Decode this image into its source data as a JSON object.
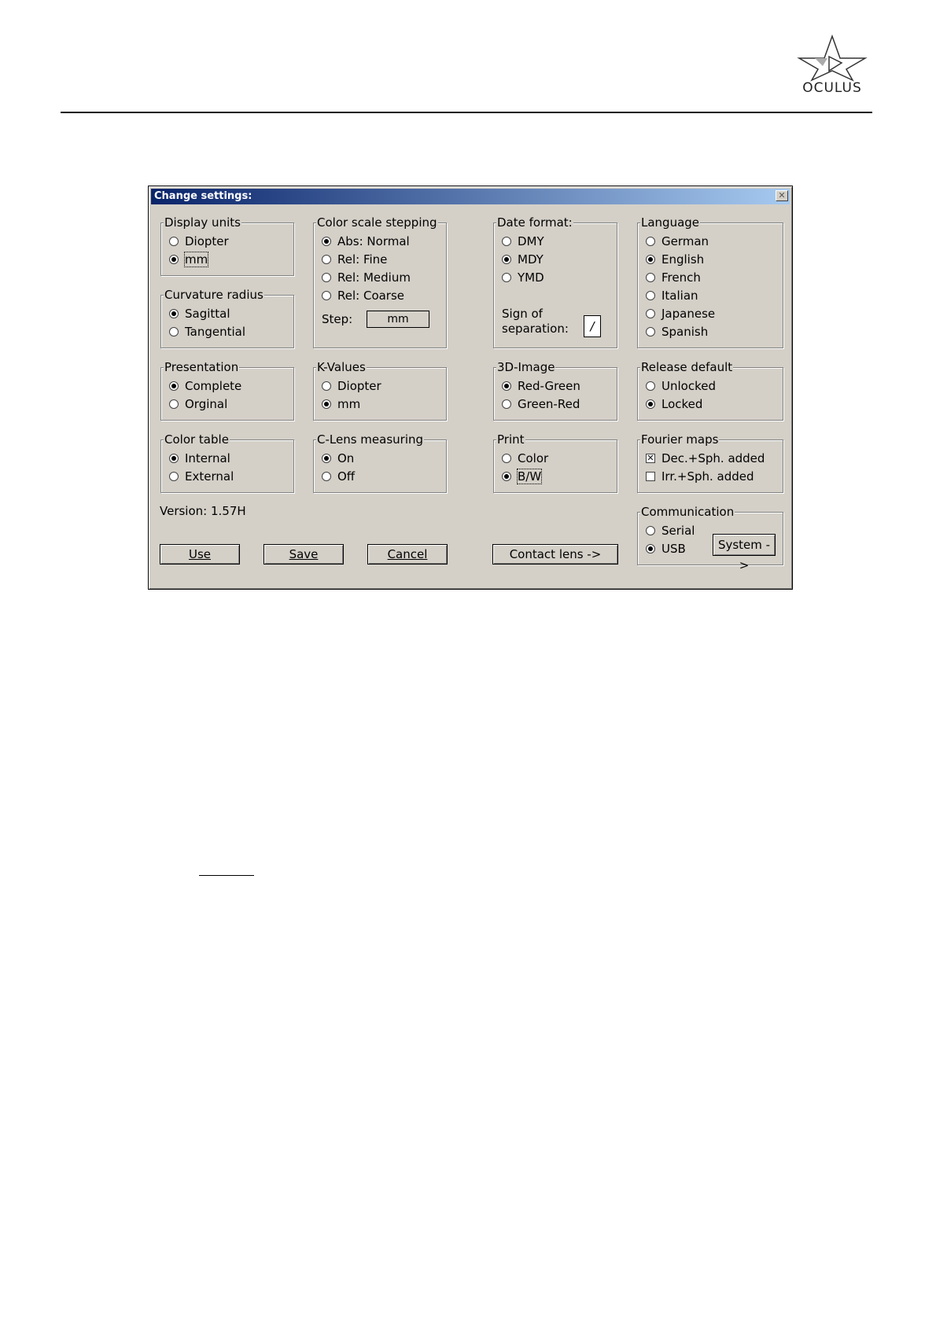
{
  "logo": {
    "text": "OCULUS"
  },
  "dialog": {
    "title": "Change settings:",
    "close_glyph": "✕",
    "display_units": {
      "label": "Display units",
      "options": [
        "Diopter",
        "mm"
      ],
      "selected": 1
    },
    "curvature_radius": {
      "label": "Curvature radius",
      "options": [
        "Sagittal",
        "Tangential"
      ],
      "selected": 0
    },
    "presentation": {
      "label": "Presentation",
      "options": [
        "Complete",
        "Orginal"
      ],
      "selected": 0
    },
    "color_table": {
      "label": "Color table",
      "options": [
        "Internal",
        "External"
      ],
      "selected": 0
    },
    "color_scale_stepping": {
      "label": "Color scale stepping",
      "options": [
        "Abs: Normal",
        "Rel: Fine",
        "Rel: Medium",
        "Rel: Coarse"
      ],
      "selected": 0,
      "step_label": "Step:",
      "step_value": "mm"
    },
    "k_values": {
      "label": "K-Values",
      "options": [
        "Diopter",
        "mm"
      ],
      "selected": 1
    },
    "c_lens_measuring": {
      "label": "C-Lens measuring",
      "options": [
        "On",
        "Off"
      ],
      "selected": 0
    },
    "date_format": {
      "label": "Date format:",
      "options": [
        "DMY",
        "MDY",
        "YMD"
      ],
      "selected": 1,
      "sign_label_1": "Sign of",
      "sign_label_2": "separation:",
      "sign_value": "/"
    },
    "image_3d": {
      "label": "3D-Image",
      "options": [
        "Red-Green",
        "Green-Red"
      ],
      "selected": 0
    },
    "print": {
      "label": "Print",
      "options": [
        "Color",
        "B/W"
      ],
      "selected": 1
    },
    "language": {
      "label": "Language",
      "options": [
        "German",
        "English",
        "French",
        "Italian",
        "Japanese",
        "Spanish"
      ],
      "selected": 1
    },
    "release_default": {
      "label": "Release default",
      "options": [
        "Unlocked",
        "Locked"
      ],
      "selected": 1
    },
    "fourier_maps": {
      "label": "Fourier maps",
      "options": [
        "Dec.+Sph. added",
        "Irr.+Sph. added"
      ],
      "checked": [
        true,
        false
      ]
    },
    "communication": {
      "label": "Communication",
      "options": [
        "Serial",
        "USB"
      ],
      "selected": 1,
      "system_button": "System ->"
    },
    "version": "Version: 1.57H",
    "buttons": {
      "use": "Use",
      "save": "Save",
      "cancel": "Cancel",
      "contact_lens": "Contact lens ->"
    }
  }
}
